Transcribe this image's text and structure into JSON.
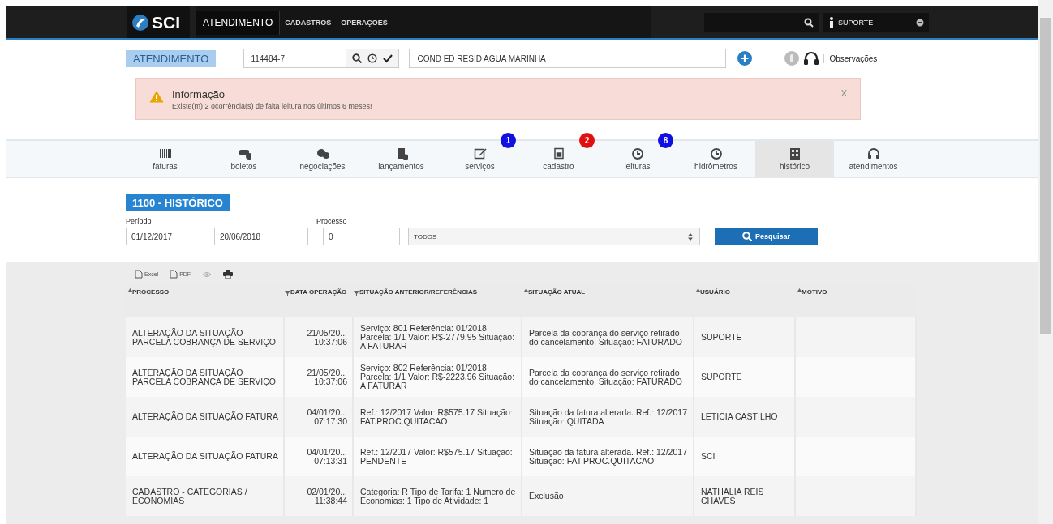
{
  "topbar": {
    "logo": "SCI",
    "nav": [
      {
        "label": "ATENDIMENTO",
        "selected": true
      },
      {
        "label": "CADASTROS",
        "selected": false
      },
      {
        "label": "OPERAÇÕES",
        "selected": false
      }
    ],
    "user": "SUPORTE"
  },
  "header": {
    "module": "ATENDIMENTO",
    "account": "114484-7",
    "client_name": "COND ED RESID AGUA MARINHA",
    "notes_link": "Observações"
  },
  "alert": {
    "title": "Informação",
    "message": "Existe(m) 2 ocorrência(s) de falta leitura nos últimos 6 meses!",
    "close": "X"
  },
  "tabs": [
    {
      "label": "faturas",
      "kind": "barcode",
      "selected": false
    },
    {
      "label": "boletos",
      "kind": "money",
      "selected": false
    },
    {
      "label": "negociações",
      "kind": "coins",
      "selected": false
    },
    {
      "label": "lançamentos",
      "kind": "doc",
      "selected": false
    },
    {
      "label": "serviços",
      "kind": "edit",
      "selected": false,
      "badge": "1",
      "color": "#1010e0"
    },
    {
      "label": "cadastro",
      "kind": "card",
      "selected": false,
      "badge": "2",
      "color": "#e01010"
    },
    {
      "label": "leituras",
      "kind": "clock",
      "selected": false,
      "badge": "8",
      "color": "#1010e0"
    },
    {
      "label": "hidrômetros",
      "kind": "clock",
      "selected": false
    },
    {
      "label": "histórico",
      "kind": "grid",
      "selected": true
    },
    {
      "label": "atendimentos",
      "kind": "headset",
      "selected": false
    }
  ],
  "section_title": "1100 - HISTÓRICO",
  "filters": {
    "period_label": "Período",
    "date_from": "01/12/2017",
    "date_to": "20/06/2018",
    "process_label": "Processo",
    "process_code": "0",
    "process_select": "TODOS",
    "search_button": "Pesquisar"
  },
  "export": [
    {
      "label": "Excel",
      "kind": "file"
    },
    {
      "label": "PDF",
      "kind": "file"
    },
    {
      "kind": "eye"
    },
    {
      "kind": "print"
    }
  ],
  "table": {
    "columns": [
      {
        "label": "PROCESSO",
        "kind": "sort"
      },
      {
        "label": "DATA OPERAÇÃO",
        "kind": "filter"
      },
      {
        "label": "SITUAÇÃO ANTERIOR/REFERÊNCIAS",
        "kind": "filter"
      },
      {
        "label": "SITUAÇÃO ATUAL",
        "kind": "sort"
      },
      {
        "label": "USUÁRIO",
        "kind": "sort"
      },
      {
        "label": "MOTIVO",
        "kind": "sort"
      }
    ],
    "rows": [
      [
        "ALTERAÇÃO DA SITUAÇÃO PARCELA COBRANÇA DE SERVIÇO",
        "21/05/20... 10:37:06",
        "Serviço: 801 Referência: 01/2018 Parcela: 1/1 Valor: R$-2779.95 Situação: A FATURAR",
        "Parcela da cobrança do serviço retirado do cancelamento. Situação: FATURADO",
        "SUPORTE",
        ""
      ],
      [
        "ALTERAÇÃO DA SITUAÇÃO PARCELA COBRANÇA DE SERVIÇO",
        "21/05/20... 10:37:06",
        "Serviço: 802 Referência: 01/2018 Parcela: 1/1 Valor: R$-2223.96 Situação: A FATURAR",
        "Parcela da cobrança do serviço retirado do cancelamento. Situação: FATURADO",
        "SUPORTE",
        ""
      ],
      [
        "ALTERAÇÃO DA SITUAÇÃO FATURA",
        "04/01/20... 07:17:30",
        "Ref.: 12/2017 Valor: R$575.17 Situação: FAT.PROC.QUITACAO",
        "Situação da fatura alterada. Ref.: 12/2017 Situação: QUITADA",
        "LETICIA CASTILHO",
        ""
      ],
      [
        "ALTERAÇÃO DA SITUAÇÃO FATURA",
        "04/01/20... 07:13:31",
        "Ref.: 12/2017 Valor: R$575.17 Situação: PENDENTE",
        "Situação da fatura alterada. Ref.: 12/2017 Situação: FAT.PROC.QUITACAO",
        "SCI",
        ""
      ],
      [
        "CADASTRO - CATEGORIAS / ECONOMIAS",
        "02/01/20... 11:38:44",
        "Categoria: R Tipo de Tarifa: 1 Numero de Economias: 1 Tipo de Atividade: 1",
        "Exclusão",
        "NATHALIA REIS CHAVES",
        ""
      ]
    ]
  }
}
